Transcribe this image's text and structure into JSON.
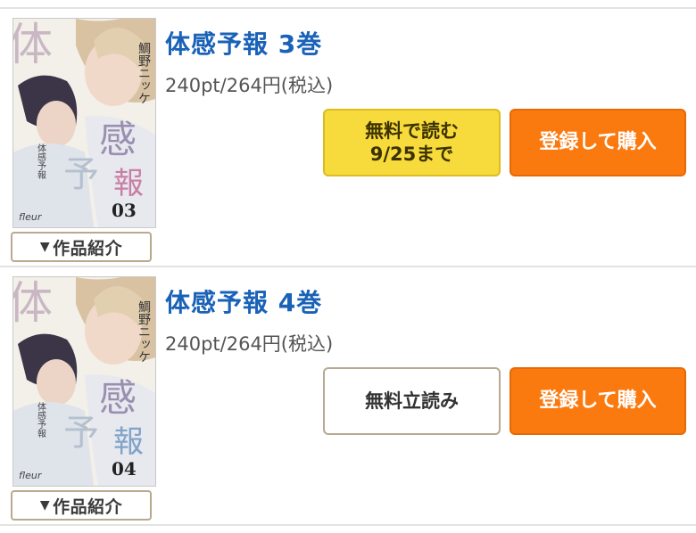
{
  "items": [
    {
      "title": "体感予報 3巻",
      "price": "240pt/264円(税込)",
      "free_button": "無料で読む\n9/25まで",
      "buy_button": "登録して購入",
      "intro_button": "作品紹介",
      "cover": {
        "big_text": "体感予報",
        "author": "鯛野ニッケ",
        "vertical_title": "体感予報",
        "volume": "03",
        "publisher": "fleur"
      }
    },
    {
      "title": "体感予報 4巻",
      "price": "240pt/264円(税込)",
      "free_button": "無料立読み",
      "buy_button": "登録して購入",
      "intro_button": "作品紹介",
      "cover": {
        "big_text": "体感予報",
        "author": "鯛野ニッケ",
        "vertical_title": "体感予報",
        "volume": "04",
        "publisher": "fleur"
      }
    }
  ],
  "colors": {
    "title": "#1a62b7",
    "free_button": "#f7da3b",
    "buy_button": "#fb7a0f"
  }
}
